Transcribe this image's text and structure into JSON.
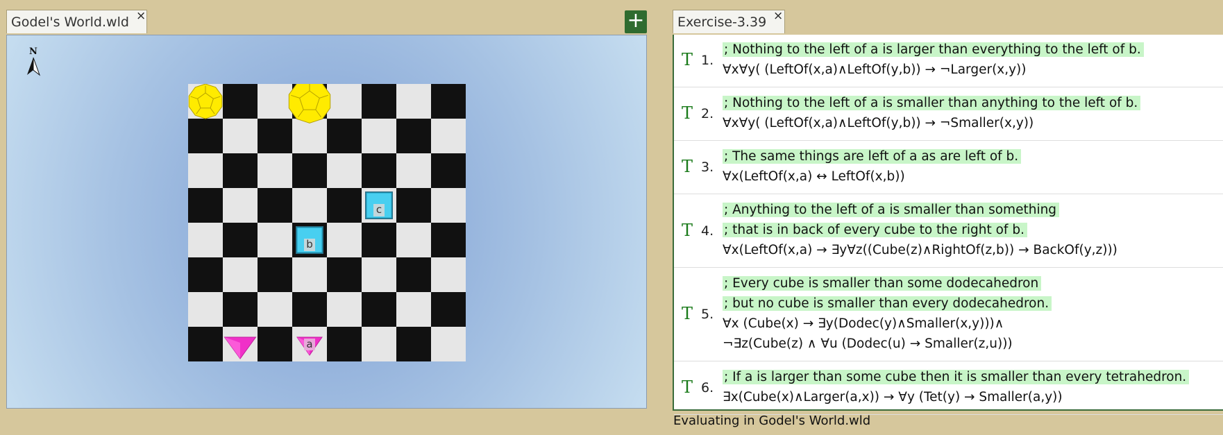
{
  "world_tab": {
    "title": "Godel's World.wld",
    "close": "×"
  },
  "add_button": {
    "label": "+"
  },
  "exercise_tab": {
    "title": "Exercise-3.39",
    "close": "×"
  },
  "compass": {
    "label": "N"
  },
  "board": {
    "size": 8,
    "light_color": "#e6e6e6",
    "dark_color": "#111111",
    "objects": [
      {
        "shape": "dodec",
        "size": "small",
        "row": 0,
        "col": 0,
        "color": "#ffeb00",
        "label": ""
      },
      {
        "shape": "dodec",
        "size": "medium",
        "row": 0,
        "col": 3,
        "color": "#ffeb00",
        "label": ""
      },
      {
        "shape": "cube",
        "size": "small",
        "row": 3,
        "col": 5,
        "color": "#48cff0",
        "label": "c"
      },
      {
        "shape": "cube",
        "size": "small",
        "row": 4,
        "col": 3,
        "color": "#48cff0",
        "label": "b"
      },
      {
        "shape": "tet",
        "size": "medium",
        "row": 7,
        "col": 1,
        "color": "#f030c8",
        "label": ""
      },
      {
        "shape": "tet",
        "size": "small",
        "row": 7,
        "col": 3,
        "color": "#f030c8",
        "label": "a"
      }
    ]
  },
  "sentences": [
    {
      "num": "1.",
      "truth": "T",
      "lines": [
        {
          "text": "; Nothing to the left of a is larger than everything to the left of b.",
          "comment": true
        },
        {
          "text": "∀x∀y( (LeftOf(x,a)∧LeftOf(y,b)) → ¬Larger(x,y))",
          "comment": false
        }
      ]
    },
    {
      "num": "2.",
      "truth": "T",
      "lines": [
        {
          "text": "; Nothing to the left of a is smaller than anything to the left of b.",
          "comment": true
        },
        {
          "text": "∀x∀y( (LeftOf(x,a)∧LeftOf(y,b)) → ¬Smaller(x,y))",
          "comment": false
        }
      ]
    },
    {
      "num": "3.",
      "truth": "T",
      "lines": [
        {
          "text": "; The same things are left of a as are left of b.",
          "comment": true
        },
        {
          "text": "∀x(LeftOf(x,a) ↔ LeftOf(x,b))",
          "comment": false
        }
      ]
    },
    {
      "num": "4.",
      "truth": "T",
      "lines": [
        {
          "text": "; Anything to the left of a is smaller than something ",
          "comment": true
        },
        {
          "text": "; that is in back of every cube to the right of b.",
          "comment": true
        },
        {
          "text": "∀x(LeftOf(x,a) → ∃y∀z((Cube(z)∧RightOf(z,b)) → BackOf(y,z)))",
          "comment": false
        }
      ]
    },
    {
      "num": "5.",
      "truth": "T",
      "lines": [
        {
          "text": "; Every cube is smaller than some dodecahedron ",
          "comment": true
        },
        {
          "text": "; but no cube is smaller than every dodecahedron.",
          "comment": true
        },
        {
          "text": "∀x (Cube(x) → ∃y(Dodec(y)∧Smaller(x,y)))∧",
          "comment": false
        },
        {
          "text": "¬∃z(Cube(z) ∧ ∀u (Dodec(u) → Smaller(z,u)))",
          "comment": false
        }
      ]
    },
    {
      "num": "6.",
      "truth": "T",
      "lines": [
        {
          "text": "; If a is larger than some cube then it is smaller than every tetrahedron. ",
          "comment": true
        },
        {
          "text": "∃x(Cube(x)∧Larger(a,x)) → ∀y (Tet(y) → Smaller(a,y))",
          "comment": false
        }
      ]
    }
  ],
  "status": "Evaluating in Godel's World.wld"
}
